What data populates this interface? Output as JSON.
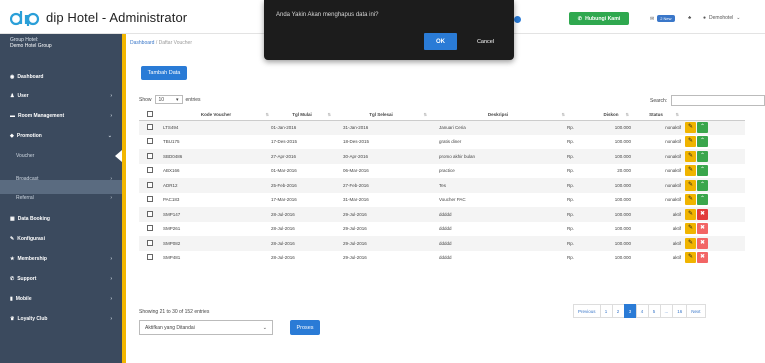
{
  "app": {
    "title": "dip Hotel - Administrator"
  },
  "header": {
    "hubungi": "Hubungi Kami",
    "new_badge": "2 New",
    "user": "Demohotel"
  },
  "dialog": {
    "message": "Anda Yakin Akan menghapus data ini?",
    "ok": "OK",
    "cancel": "Cancel"
  },
  "sidebar": {
    "group_label": "Group Hotel:",
    "group_name": "Demo Hotel Group",
    "items": [
      {
        "label": "Dashboard",
        "icon": "dashboard-icon"
      },
      {
        "label": "User",
        "icon": "user-icon"
      },
      {
        "label": "Room Management",
        "icon": "room-icon"
      },
      {
        "label": "Promotion",
        "icon": "promotion-icon"
      },
      {
        "label": "Voucher",
        "icon": ""
      },
      {
        "label": "Broadcast",
        "icon": ""
      },
      {
        "label": "Referral",
        "icon": ""
      },
      {
        "label": "Data Booking",
        "icon": "booking-icon"
      },
      {
        "label": "Konfigurasi",
        "icon": "config-icon"
      },
      {
        "label": "Membership",
        "icon": "membership-icon"
      },
      {
        "label": "Support",
        "icon": "support-icon"
      },
      {
        "label": "Mobile",
        "icon": "mobile-icon"
      },
      {
        "label": "Loyalty Club",
        "icon": "loyalty-icon"
      }
    ]
  },
  "breadcrumb": {
    "home": "Dashboard",
    "sep": "/",
    "current": "Daftar Voucher"
  },
  "toolbar": {
    "add": "Tambah Data",
    "show": "Show",
    "entries_value": "10",
    "entries": "entries",
    "search": "Search:"
  },
  "table": {
    "headers": [
      "Kode Voucher",
      "Tgl Mulai",
      "Tgl Selesai",
      "Deskripsi",
      "Diskon",
      "Status"
    ],
    "rows": [
      {
        "kode": "LTS494",
        "mulai": "01-Jan-2016",
        "selesai": "31-Jan-2016",
        "desk": "Januari Ceria",
        "cur": "Rp.",
        "diskon": "100.000",
        "status": "nonaktif"
      },
      {
        "kode": "TBU175",
        "mulai": "17-Des-2015",
        "selesai": "18-Des-2015",
        "desk": "gratis diner",
        "cur": "Rp.",
        "diskon": "100.000",
        "status": "nonaktif"
      },
      {
        "kode": "SBD0486",
        "mulai": "27-Apr-2016",
        "selesai": "30-Apr-2016",
        "desk": "promo akhir bulan",
        "cur": "Rp.",
        "diskon": "100.000",
        "status": "nonaktif"
      },
      {
        "kode": "ABX166",
        "mulai": "01-Mar-2016",
        "selesai": "06-Mar-2016",
        "desk": "practice",
        "cur": "Rp.",
        "diskon": "20.000",
        "status": "nonaktif"
      },
      {
        "kode": "ADR12",
        "mulai": "25-Feb-2016",
        "selesai": "27-Feb-2016",
        "desk": "Tes",
        "cur": "Rp.",
        "diskon": "100.000",
        "status": "nonaktif"
      },
      {
        "kode": "PAC183",
        "mulai": "17-Mar-2016",
        "selesai": "31-Mar-2016",
        "desk": "Voucher PAC",
        "cur": "Rp.",
        "diskon": "100.000",
        "status": "nonaktif"
      },
      {
        "kode": "SMP147",
        "mulai": "28-Jul-2016",
        "selesai": "29-Jul-2016",
        "desk": "ddddd",
        "cur": "Rp.",
        "diskon": "100.000",
        "status": "aktif"
      },
      {
        "kode": "SMP261",
        "mulai": "28-Jul-2016",
        "selesai": "29-Jul-2016",
        "desk": "ddddd",
        "cur": "Rp.",
        "diskon": "100.000",
        "status": "aktif"
      },
      {
        "kode": "SMP082",
        "mulai": "28-Jul-2016",
        "selesai": "29-Jul-2016",
        "desk": "ddddd",
        "cur": "Rp.",
        "diskon": "100.000",
        "status": "aktif"
      },
      {
        "kode": "SMP481",
        "mulai": "28-Jul-2016",
        "selesai": "29-Jul-2016",
        "desk": "ddddd",
        "cur": "Rp.",
        "diskon": "100.000",
        "status": "aktif"
      }
    ]
  },
  "footer": {
    "info": "Showing 21 to 30 of 152 entries",
    "bulk": "Aktifkan yang Ditandai",
    "proses": "Proses"
  },
  "pagination": [
    "Previous",
    "1",
    "2",
    "3",
    "4",
    "5",
    "...",
    "16",
    "Next"
  ],
  "colors": {
    "primary": "#2a7bd6",
    "sidebar": "#3b4a5e",
    "accent": "#f2b600",
    "success": "#2fa84f",
    "danger": "#e23b3b"
  }
}
